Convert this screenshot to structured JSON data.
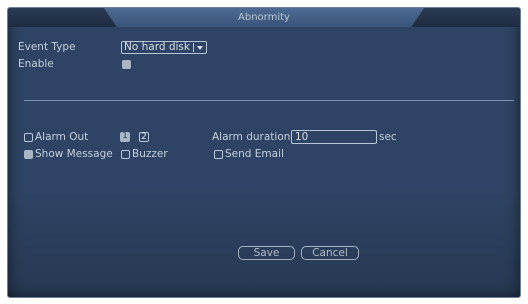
{
  "dialog": {
    "title": "Abnormity"
  },
  "event_type": {
    "label": "Event Type",
    "value": "No hard disk"
  },
  "enable": {
    "label": "Enable",
    "checked": true
  },
  "alarm_out": {
    "label": "Alarm Out",
    "checked": false,
    "channels": [
      {
        "label": "1",
        "selected": true
      },
      {
        "label": "2",
        "selected": false
      }
    ]
  },
  "alarm_duration": {
    "label": "Alarm duration",
    "value": "10",
    "unit": "sec"
  },
  "show_message": {
    "label": "Show Message",
    "checked": true
  },
  "buzzer": {
    "label": "Buzzer",
    "checked": false
  },
  "send_email": {
    "label": "Send Email",
    "checked": false
  },
  "buttons": {
    "save": "Save",
    "cancel": "Cancel"
  },
  "colors": {
    "panel": "#2f4464",
    "title_tab": "#4d6b93",
    "text": "#c4cfde",
    "border": "#b8c7da"
  }
}
